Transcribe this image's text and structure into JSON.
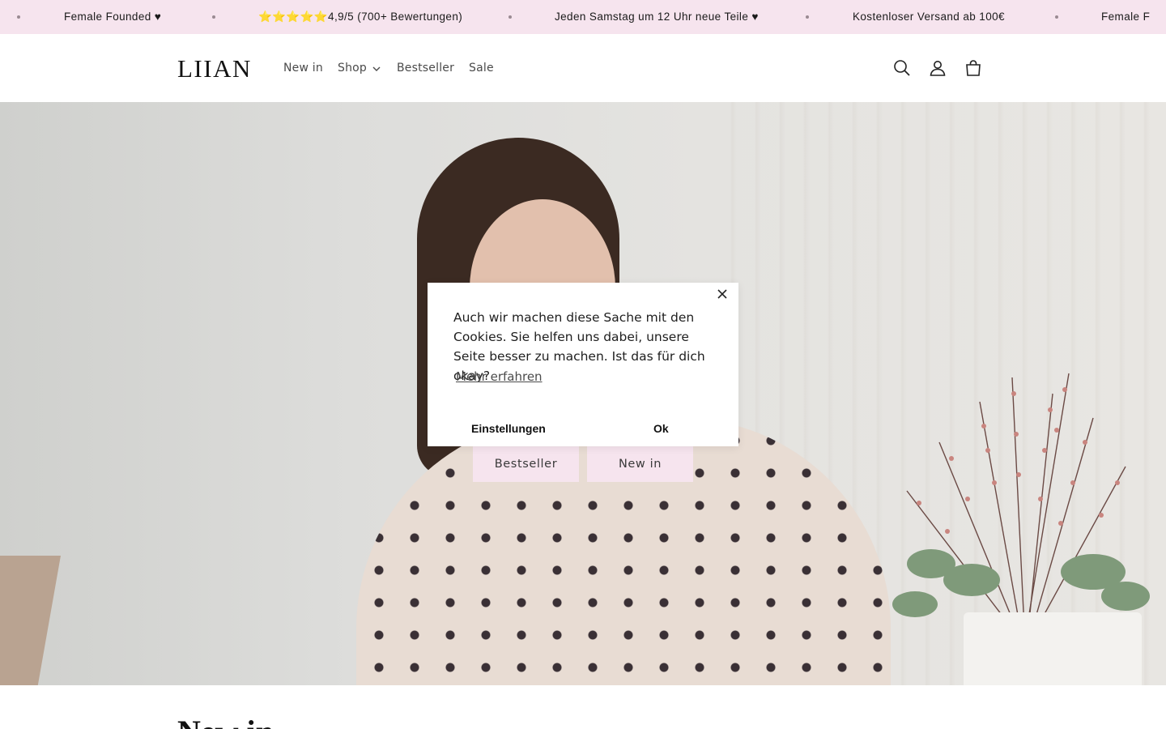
{
  "announcement": {
    "messages": [
      "Female Founded ♥",
      "⭐⭐⭐⭐⭐4,9/5 (700+ Bewertungen)",
      "Jeden Samstag um 12 Uhr neue Teile ♥",
      "Kostenloser Versand ab 100€",
      "Female F"
    ]
  },
  "header": {
    "logo": "LIIAN",
    "nav": [
      "New in",
      "Shop",
      "Bestseller",
      "Sale"
    ],
    "icons": [
      "search-icon",
      "account-icon",
      "cart-icon"
    ]
  },
  "hero": {
    "buttons": [
      "Bestseller",
      "New in"
    ]
  },
  "cookie": {
    "text": "Auch wir machen diese Sache mit den Cookies. Sie helfen uns dabei, unsere Seite besser zu machen. Ist das für dich okay?",
    "more_link": "Mehr erfahren",
    "settings_label": "Einstellungen",
    "ok_label": "Ok"
  },
  "section": {
    "title": "New in"
  },
  "colors": {
    "announcement_bg": "#f6e4ee",
    "button_bg": "#f6e4ee"
  }
}
